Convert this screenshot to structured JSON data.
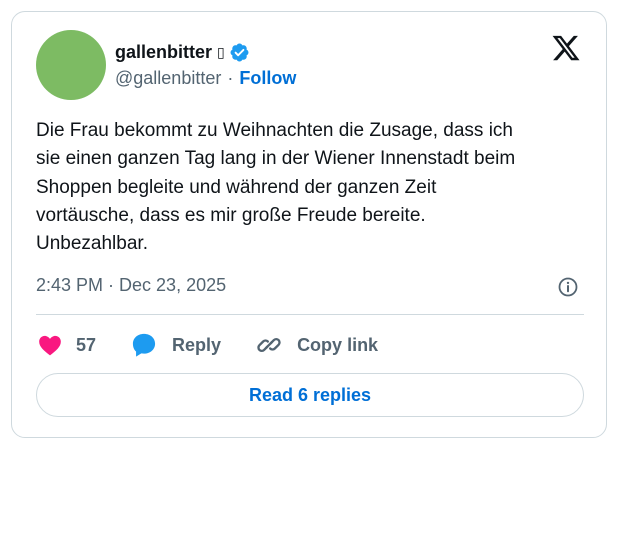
{
  "author": {
    "display_name": "gallenbitter",
    "name_suffix_glyph": "▯",
    "handle": "@gallenbitter",
    "separator": "·",
    "follow_label": "Follow",
    "avatar_color": "#7dbb63",
    "verified_color": "#1d9bf0"
  },
  "tweet": {
    "text": "Die Frau bekommt zu Weihnachten die Zusage, dass ich\nsie einen ganzen Tag lang in der Wiener Innenstadt beim\nShoppen begleite und während der ganzen Zeit\nvortäusche, dass es mir große Freude bereite.\nUnbezahlbar.",
    "timestamp": "2:43 PM · Dec 23, 2025"
  },
  "actions": {
    "like_count": "57",
    "reply_label": "Reply",
    "copy_link_label": "Copy link"
  },
  "footer": {
    "read_replies_label": "Read 6 replies"
  },
  "colors": {
    "like": "#f91880",
    "reply": "#1d9bf0",
    "link": "#006fd6",
    "secondary_text": "#536471",
    "border": "#cfd9de"
  },
  "icons": [
    "verified-badge-icon",
    "x-logo-icon",
    "info-icon",
    "heart-icon",
    "reply-bubble-icon",
    "link-icon"
  ]
}
